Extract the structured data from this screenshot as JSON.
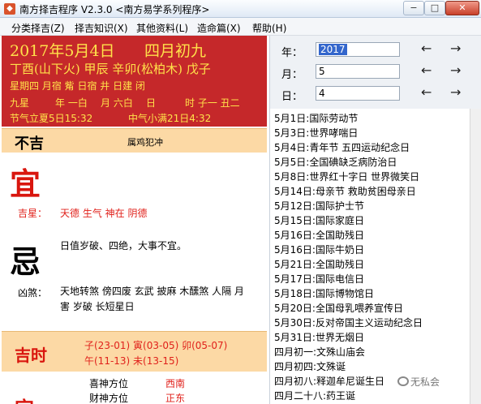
{
  "window": {
    "title": "南方择吉程序 V2.3.0  <南方易学系列程序>",
    "minimize": "−",
    "maximize": "□",
    "close": "✕"
  },
  "menu": [
    {
      "label": "分类择吉(Z)"
    },
    {
      "label": "择吉知识(X)"
    },
    {
      "label": "其他资料(L)"
    },
    {
      "label": "造命篇(X)"
    },
    {
      "label": "帮助(H)"
    }
  ],
  "header": {
    "solar_date": "2017年5月4日",
    "lunar_date": "四月初九",
    "ganzhi": "丁酉(山下火) 甲辰 辛卯(松柏木) 戊子",
    "line3": "星期四  月宿 觜  日宿 井  日建 闭",
    "jiuxing_label": "九星",
    "jiuxing_year": "年 一白",
    "jiuxing_month": "月 六白",
    "jiuxing_day": "日",
    "jiuxing_hour": "时 子一 丑二",
    "jieqi1": "节气立夏5日15:32",
    "jieqi2": "中气小满21日4:32"
  },
  "bad": {
    "label": "不吉",
    "text": "属鸡犯冲"
  },
  "yi": {
    "char": "宜",
    "jixing_label": "吉星：",
    "jixing_value": "天德 生气 神在 阴德"
  },
  "ji": {
    "char": "忌",
    "desc": "日值岁破、四绝，大事不宜。",
    "xiongsha_label": "凶煞：",
    "xiongsha_line1": "天地转煞 傍四废 玄武 披麻 木醺煞 人隔 月",
    "xiongsha_line2": "害 岁破 长短星日"
  },
  "jishi": {
    "label": "吉时",
    "line1": "子(23-01) 寅(03-05) 卯(05-07)",
    "line2": "午(11-13) 未(13-15)"
  },
  "directions": {
    "xishen_label": "喜神方位",
    "xishen_value": "西南",
    "caishen_label": "财神方位",
    "caishen_value": "正东",
    "partial_char": "宜"
  },
  "controls": {
    "year_label": "年：",
    "year_value": "2017",
    "month_label": "月：",
    "month_value": "5",
    "day_label": "日：",
    "day_value": "4",
    "prev": "←",
    "next": "→"
  },
  "holidays": [
    "5月1日:国际劳动节",
    "5月3日:世界哮喘日",
    "5月4日:青年节 五四运动纪念日",
    "5月5日:全国碘缺乏病防治日",
    "5月8日:世界红十字日 世界微笑日",
    "5月14日:母亲节 救助贫困母亲日",
    "5月12日:国际护士节",
    "5月15日:国际家庭日",
    "5月16日:全国助残日",
    "5月16日:国际牛奶日",
    "5月21日:全国助残日",
    "5月17日:国际电信日",
    "5月18日:国际博物馆日",
    "5月20日:全国母乳喂养宣传日",
    "5月30日:反对帝国主义运动纪念日",
    "5月31日:世界无烟日",
    "四月初一:文殊山庙会",
    "四月初四:文殊诞",
    "四月初八:释迦牟尼诞生日",
    "四月二十八:药王诞"
  ],
  "watermark": "无私会",
  "colors": {
    "header_bg": "#c5282a",
    "header_text": "#ffe14a",
    "band_bg": "#fcd9a5",
    "red_text": "#e0211b"
  }
}
